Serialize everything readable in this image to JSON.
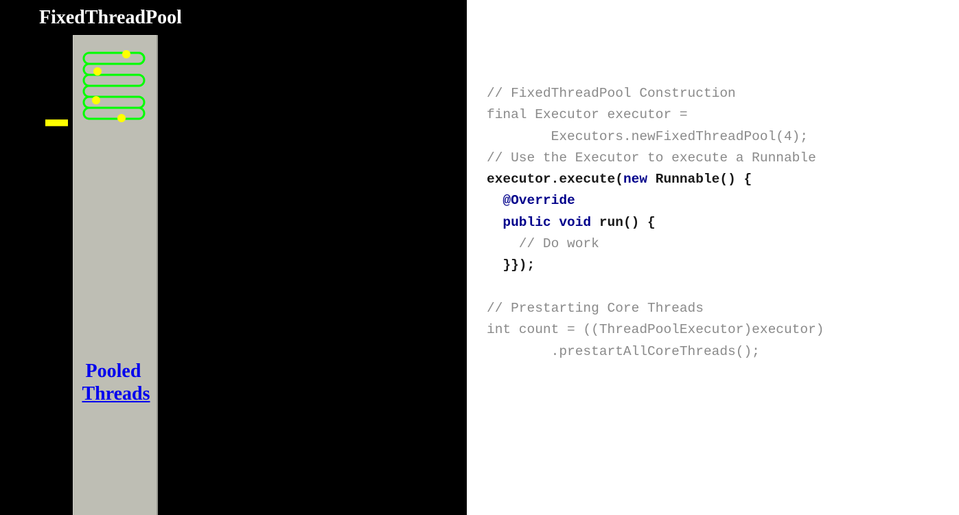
{
  "title": "FixedThreadPool",
  "pool": {
    "label_line1": "Pooled",
    "label_line2": "Threads",
    "thread_count": 4,
    "loop_color": "#00ff00",
    "dot_color": "#ffff00",
    "queue_marker_color": "#ffff00",
    "background_color": "#bebeb4"
  },
  "code": {
    "lines": [
      [
        {
          "t": "// FixedThreadPool Construction",
          "s": "c"
        }
      ],
      [
        {
          "t": "final Executor executor =",
          "s": "c"
        }
      ],
      [
        {
          "t": "        Executors.newFixedThreadPool(4);",
          "s": "c"
        }
      ],
      [
        {
          "t": "// Use the Executor to execute a Runnable",
          "s": "c"
        }
      ],
      [
        {
          "t": "executor.execute(",
          "s": "b"
        },
        {
          "t": "new",
          "s": "k"
        },
        {
          "t": " Runnable() {",
          "s": "b"
        }
      ],
      [
        {
          "t": "  ",
          "s": "b"
        },
        {
          "t": "@Override",
          "s": "k"
        }
      ],
      [
        {
          "t": "  ",
          "s": "b"
        },
        {
          "t": "public",
          "s": "k"
        },
        {
          "t": " ",
          "s": "b"
        },
        {
          "t": "void",
          "s": "k"
        },
        {
          "t": " run() {",
          "s": "b"
        }
      ],
      [
        {
          "t": "    // Do work",
          "s": "c"
        }
      ],
      [
        {
          "t": "  }});",
          "s": "b"
        }
      ],
      [
        {
          "t": "",
          "s": "c"
        }
      ],
      [
        {
          "t": "// Prestarting Core Threads",
          "s": "c"
        }
      ],
      [
        {
          "t": "int count = ((ThreadPoolExecutor)executor)",
          "s": "c"
        }
      ],
      [
        {
          "t": "        .prestartAllCoreThreads();",
          "s": "c"
        }
      ]
    ]
  }
}
